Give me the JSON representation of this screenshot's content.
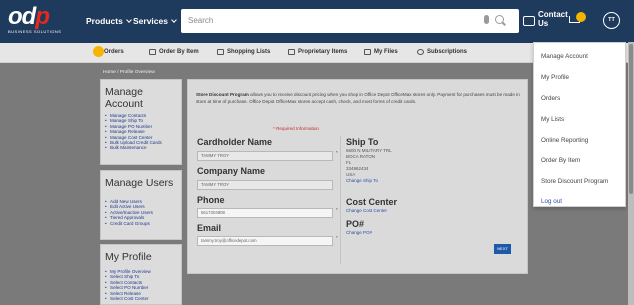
{
  "brand": {
    "logo_text": "odp",
    "logo_sub": "BUSINESS SOLUTIONS"
  },
  "nav": {
    "products": "Products",
    "services": "Services",
    "search_placeholder": "Search",
    "contact": "Contact Us",
    "avatar_initials": "TT"
  },
  "subnav": [
    {
      "label": "Orders",
      "icon": "orders-icon"
    },
    {
      "label": "Order By Item",
      "icon": "order-by-item-icon"
    },
    {
      "label": "Shopping Lists",
      "icon": "shopping-lists-icon"
    },
    {
      "label": "Proprietary Items",
      "icon": "proprietary-items-icon"
    },
    {
      "label": "My Files",
      "icon": "my-files-icon"
    },
    {
      "label": "Subscriptions",
      "icon": "subscriptions-icon"
    }
  ],
  "breadcrumb": "Home / Profile Overview",
  "sidebar": {
    "manage_account": {
      "title": "Manage Account",
      "items": [
        "Manage Contacts",
        "Manage Ship To",
        "Manage PO Number",
        "Manage Release",
        "Manage Cost Center",
        "Bulk Upload Credit Cards",
        "Bulk Maintenance"
      ]
    },
    "manage_users": {
      "title": "Manage Users",
      "items": [
        "Add New Users",
        "Edit Active Users",
        "Active/Inactive Users",
        "Tiered Approvals",
        "Credit Card Groups"
      ]
    },
    "my_profile": {
      "title": "My Profile",
      "items": [
        "My Profile Overview",
        "Select Ship To",
        "Select Contacts",
        "Select PO Number",
        "Select Release",
        "Select Cost Center"
      ]
    }
  },
  "main": {
    "intro_bold": "Store Discount Program",
    "intro_text": " allows you to receive discount pricing when you shop in Office Depot OfficeMax stores only. Payment for purchases must be made in store at time of purchase. Office Depot OfficeMax stores accept cash, check, and most forms of credit cards.",
    "required": "* Required Information",
    "cardholder_label": "Cardholder Name",
    "cardholder_value": "TAMMY TROY",
    "company_label": "Company Name",
    "company_value": "TAMMY TROY",
    "phone_label": "Phone",
    "phone_value": "5617304808",
    "email_label": "Email",
    "email_value": "tammy.troy@officedepot.com",
    "ship_to_label": "Ship To",
    "ship_to_lines": [
      "6600 N MILITARY TRL",
      "BOCA RATON",
      "FL",
      "334962434",
      "USA"
    ],
    "change_ship_to": "Change Ship To",
    "cost_center_label": "Cost Center",
    "change_cost_center": "Change Cost Center",
    "po_label": "PO#",
    "change_po": "Change PO#",
    "next": "NEXT",
    "required_star": "*"
  },
  "dropdown": {
    "items": [
      "Manage Account",
      "My Profile",
      "Orders",
      "My Lists",
      "Online Reporting",
      "Order By Item",
      "Store Discount Program",
      "Log out"
    ]
  },
  "colors": {
    "nav_bg": "#1e3a5c",
    "accent": "#f4b400",
    "brand_red": "#e5291c",
    "link": "#2b4fa8"
  }
}
